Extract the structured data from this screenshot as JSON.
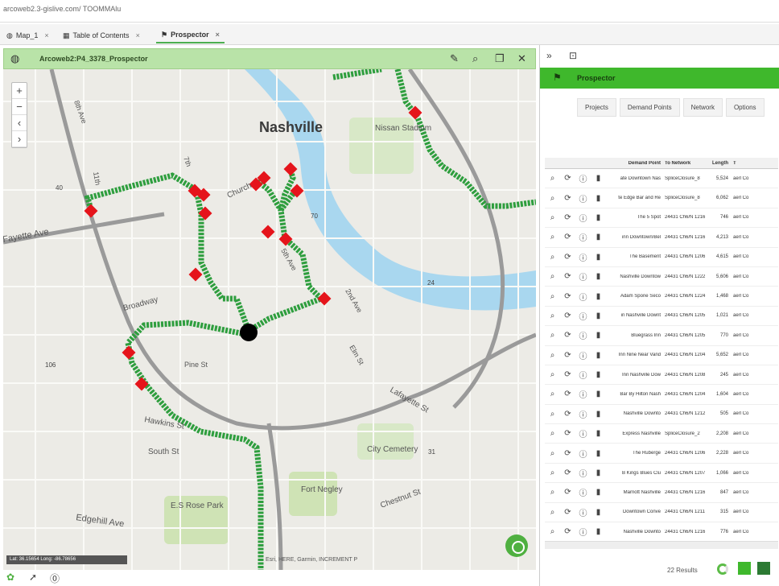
{
  "browser": {
    "url": "arcoweb2.3-gislive.com/ TOOMMAlu"
  },
  "tabs": [
    {
      "label": "Map_1",
      "icon": "globe-icon"
    },
    {
      "label": "Table of Contents",
      "icon": "table-icon"
    },
    {
      "label": "Prospector",
      "icon": "flag-icon"
    }
  ],
  "map_window": {
    "title": "Arcoweb2:P4_3378_Prospector"
  },
  "map": {
    "labels": {
      "city": "Nashville",
      "stadium": "Nissan Stadium",
      "cemetery": "City Cemetery",
      "fort": "Fort Negley",
      "park": "E.S Rose Park",
      "hawkins": "Hawkins St",
      "south": "South St",
      "edgehill": "Edgehill Ave",
      "chestnut": "Chestnut St",
      "lafayette": "Lafayette St",
      "broadway": "Broadway",
      "church": "Church",
      "pine": "Pine St",
      "fayette": "Fayette Ave",
      "eighth": "8th Ave",
      "eleventh": "11th",
      "elm": "Elm St",
      "second": "2nd Ave",
      "fifth": "5th Ave",
      "seventh": "7th",
      "r1": "40",
      "r2": "70",
      "r3": "106",
      "r4": "24",
      "r5": "31"
    },
    "attribution": "Esri, HERE, Garmin, INCREMENT P",
    "scale_text": "Lat: 36.15654  Long: -86.78656",
    "colors": {
      "route": "#2e9e3e",
      "demand_point": "#e5141b",
      "facility": "#000000",
      "water": "#a9d7ef"
    }
  },
  "panel": {
    "title": "Prospector",
    "tabs": [
      "Projects",
      "Demand Points",
      "Network",
      "Options"
    ],
    "columns": [
      "Demand Point",
      "To Network",
      "Length",
      "T"
    ],
    "rows": [
      {
        "dp": "ate Downtown Nas",
        "net": "SpliceClosure_8",
        "len": "5,524",
        "x": "aerl Co"
      },
      {
        "dp": "te Edge Bar and Re",
        "net": "SpliceClosure_8",
        "len": "6,062",
        "x": "aerl Co"
      },
      {
        "dp": "The 5 Spot",
        "net": "24431 Ch6/N 1216",
        "len": "746",
        "x": "aerl Co"
      },
      {
        "dp": "inn Downtown/Bel",
        "net": "24431 Ch6/N 1216",
        "len": "4,213",
        "x": "aerl Co"
      },
      {
        "dp": "The Basement",
        "net": "24431 Ch6/N 1206",
        "len": "4,615",
        "x": "aerl Co"
      },
      {
        "dp": "Nashville Downtow",
        "net": "24431 Ch6/N 1222",
        "len": "5,606",
        "x": "aerl Co"
      },
      {
        "dp": "Adam Spone Seco",
        "net": "24431 Ch6/N 1224",
        "len": "1,468",
        "x": "aerl Co"
      },
      {
        "dp": "in Nashville Downt",
        "net": "24431 Ch6/N 1205",
        "len": "1,021",
        "x": "aerl Co"
      },
      {
        "dp": "Bluegrass Inn",
        "net": "24431 Ch6/N 1205",
        "len": "770",
        "x": "aerl Co"
      },
      {
        "dp": "Inn Nine Near Vand",
        "net": "24431 Ch6/N 1204",
        "len": "5,652",
        "x": "aerl Co"
      },
      {
        "dp": "Inn Nashville Dow",
        "net": "24431 Ch6/N 1208",
        "len": "245",
        "x": "aerl Co"
      },
      {
        "dp": "Bar By Hilton Nash",
        "net": "24431 Ch6/N 1204",
        "len": "1,604",
        "x": "aerl Co"
      },
      {
        "dp": "Nashville Downto",
        "net": "24431 Ch6/N 1212",
        "len": "505",
        "x": "aerl Co"
      },
      {
        "dp": "Express Nashville",
        "net": "SpliceClosure_2",
        "len": "2,208",
        "x": "aerl Co"
      },
      {
        "dp": "The Ruberge",
        "net": "24431 Ch6/N 1206",
        "len": "2,228",
        "x": "aerl Co"
      },
      {
        "dp": "B Kings Blues Clu",
        "net": "24431 Ch6/N 1207",
        "len": "1,066",
        "x": "aerl Co"
      },
      {
        "dp": "Marriott Nashville",
        "net": "24431 Ch6/N 1216",
        "len": "847",
        "x": "aerl Co"
      },
      {
        "dp": "Downtown Conve",
        "net": "24431 Ch6/N 1211",
        "len": "315",
        "x": "aerl Co"
      },
      {
        "dp": "Nashville Downto",
        "net": "24431 Ch6/N 1216",
        "len": "776",
        "x": "aerl Co"
      }
    ],
    "results": "22 Results"
  }
}
